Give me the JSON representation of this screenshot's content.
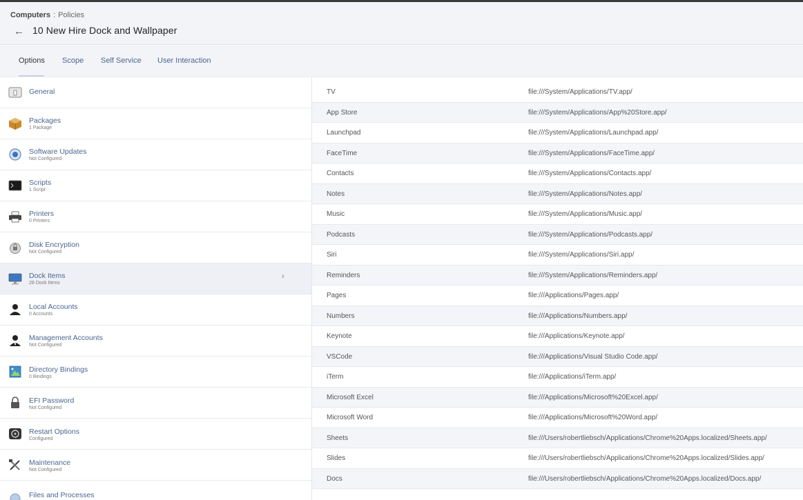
{
  "header": {
    "breadcrumb_root": "Computers",
    "breadcrumb_sep": ":",
    "breadcrumb_child": "Policies",
    "back_glyph": "←",
    "title": "10 New Hire Dock and Wallpaper"
  },
  "tabs": [
    {
      "label": "Options",
      "active": true
    },
    {
      "label": "Scope",
      "active": false
    },
    {
      "label": "Self Service",
      "active": false
    },
    {
      "label": "User Interaction",
      "active": false
    }
  ],
  "sidebar": {
    "items": [
      {
        "label": "General",
        "sub": "",
        "icon": "general-icon"
      },
      {
        "label": "Packages",
        "sub": "1 Package",
        "icon": "package-icon"
      },
      {
        "label": "Software Updates",
        "sub": "Not Configured",
        "icon": "software-update-icon"
      },
      {
        "label": "Scripts",
        "sub": "1 Script",
        "icon": "terminal-icon"
      },
      {
        "label": "Printers",
        "sub": "0 Printers",
        "icon": "printer-icon"
      },
      {
        "label": "Disk Encryption",
        "sub": "Not Configured",
        "icon": "disk-encryption-icon"
      },
      {
        "label": "Dock Items",
        "sub": "28 Dock Items",
        "icon": "monitor-icon",
        "selected": true
      },
      {
        "label": "Local Accounts",
        "sub": "0 Accounts",
        "icon": "user-icon"
      },
      {
        "label": "Management Accounts",
        "sub": "Not Configured",
        "icon": "manager-user-icon"
      },
      {
        "label": "Directory Bindings",
        "sub": "0 Bindings",
        "icon": "directory-icon"
      },
      {
        "label": "EFI Password",
        "sub": "Not Configured",
        "icon": "lock-icon"
      },
      {
        "label": "Restart Options",
        "sub": "Configured",
        "icon": "restart-icon"
      },
      {
        "label": "Maintenance",
        "sub": "Not Configured",
        "icon": "tools-icon"
      },
      {
        "label": "Files and Processes",
        "sub": "",
        "icon": "files-icon"
      }
    ],
    "chevron": "›"
  },
  "dock_items": [
    {
      "name": "TV",
      "path": "file:///System/Applications/TV.app/"
    },
    {
      "name": "App Store",
      "path": "file:///System/Applications/App%20Store.app/"
    },
    {
      "name": "Launchpad",
      "path": "file:///System/Applications/Launchpad.app/"
    },
    {
      "name": "FaceTime",
      "path": "file:///System/Applications/FaceTime.app/"
    },
    {
      "name": "Contacts",
      "path": "file:///System/Applications/Contacts.app/"
    },
    {
      "name": "Notes",
      "path": "file:///System/Applications/Notes.app/"
    },
    {
      "name": "Music",
      "path": "file:///System/Applications/Music.app/"
    },
    {
      "name": "Podcasts",
      "path": "file:///System/Applications/Podcasts.app/"
    },
    {
      "name": "Siri",
      "path": "file:///System/Applications/Siri.app/"
    },
    {
      "name": "Reminders",
      "path": "file:///System/Applications/Reminders.app/"
    },
    {
      "name": "Pages",
      "path": "file:///Applications/Pages.app/"
    },
    {
      "name": "Numbers",
      "path": "file:///Applications/Numbers.app/"
    },
    {
      "name": "Keynote",
      "path": "file:///Applications/Keynote.app/"
    },
    {
      "name": "VSCode",
      "path": "file:///Applications/Visual Studio Code.app/"
    },
    {
      "name": "iTerm",
      "path": "file:///Applications/iTerm.app/"
    },
    {
      "name": "Microsoft Excel",
      "path": "file:///Applications/Microsoft%20Excel.app/"
    },
    {
      "name": "Microsoft Word",
      "path": "file:///Applications/Microsoft%20Word.app/"
    },
    {
      "name": "Sheets",
      "path": "file:///Users/robertliebsch/Applications/Chrome%20Apps.localized/Sheets.app/"
    },
    {
      "name": "Slides",
      "path": "file:///Users/robertliebsch/Applications/Chrome%20Apps.localized/Slides.app/"
    },
    {
      "name": "Docs",
      "path": "file:///Users/robertliebsch/Applications/Chrome%20Apps.localized/Docs.app/"
    }
  ]
}
